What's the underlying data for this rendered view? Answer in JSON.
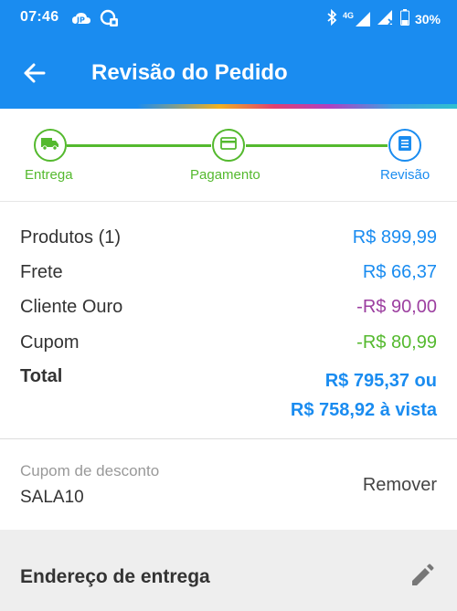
{
  "status_bar": {
    "time": "07:46",
    "network": "4G",
    "battery": "30%",
    "icons": [
      "cloud-icon",
      "data-saver-icon",
      "bluetooth-icon",
      "signal-icon",
      "signal-no-service-icon",
      "battery-icon"
    ]
  },
  "app_bar": {
    "title": "Revisão do Pedido",
    "back_icon": "arrow-left-icon"
  },
  "stepper": {
    "steps": [
      {
        "label": "Entrega",
        "icon": "truck-icon",
        "state": "done"
      },
      {
        "label": "Pagamento",
        "icon": "credit-card-icon",
        "state": "done"
      },
      {
        "label": "Revisão",
        "icon": "document-icon",
        "state": "active"
      }
    ]
  },
  "summary": {
    "products_label": "Produtos (1)",
    "products_value": "R$ 899,99",
    "shipping_label": "Frete",
    "shipping_value": "R$ 66,37",
    "gold_label": "Cliente Ouro",
    "gold_value": "-R$ 90,00",
    "coupon_label": "Cupom",
    "coupon_value": "-R$ 80,99",
    "total_label": "Total",
    "total_value": "R$ 795,37 ou",
    "total_cash_value": "R$ 758,92 à vista"
  },
  "coupon": {
    "label": "Cupom de desconto",
    "code": "SALA10",
    "remove_label": "Remover"
  },
  "address": {
    "title": "Endereço de entrega",
    "edit_icon": "pencil-icon"
  },
  "colors": {
    "primary": "#1a8cf0",
    "success": "#54b92e",
    "discount_gold": "#9c3fa0"
  }
}
